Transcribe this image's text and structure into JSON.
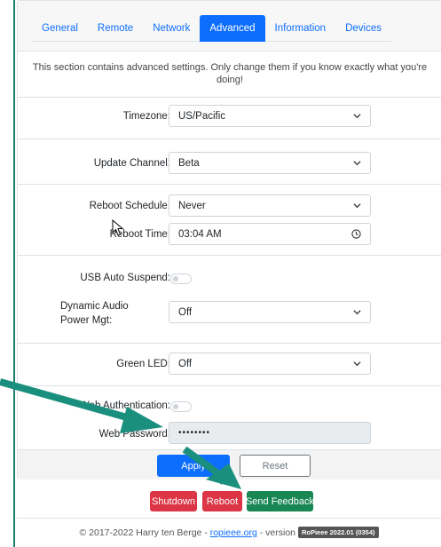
{
  "tabs": [
    {
      "label": "General",
      "active": false
    },
    {
      "label": "Remote",
      "active": false
    },
    {
      "label": "Network",
      "active": false
    },
    {
      "label": "Advanced",
      "active": true
    },
    {
      "label": "Information",
      "active": false
    },
    {
      "label": "Devices",
      "active": false
    }
  ],
  "description": "This section contains advanced settings. Only change them if you know exactly what you're doing!",
  "fields": {
    "timezone": {
      "label": "Timezone:",
      "value": "US/Pacific"
    },
    "update_channel": {
      "label": "Update Channel:",
      "value": "Beta"
    },
    "reboot_schedule": {
      "label": "Reboot Schedule:",
      "value": "Never"
    },
    "reboot_time": {
      "label": "Reboot Time:",
      "value": "03:04 AM"
    },
    "usb_auto_suspend": {
      "label": "USB Auto Suspend:",
      "enabled": false
    },
    "dynamic_audio_power": {
      "label": "Dynamic Audio Power Mgt:",
      "value": "Off"
    },
    "green_led": {
      "label": "Green LED:",
      "value": "Off"
    },
    "web_authentication": {
      "label": "Web Authentication:",
      "enabled": false
    },
    "web_password": {
      "label": "Web Password:",
      "value": "••••••••"
    }
  },
  "buttons": {
    "apply": "Apply",
    "reset": "Reset",
    "shutdown": "Shutdown",
    "reboot": "Reboot",
    "send_feedback": "Send Feedback"
  },
  "footer": {
    "copyright_prefix": "© 2017-2022 Harry ten Berge - ",
    "link": "ropieee.org",
    "version_prefix": " - version ",
    "version": "RoPieee 2022.01 (0354)"
  },
  "colors": {
    "accent": "#0d6efd",
    "danger": "#dc3545",
    "success": "#198754",
    "annotation_arrow": "#1a8f7e"
  }
}
